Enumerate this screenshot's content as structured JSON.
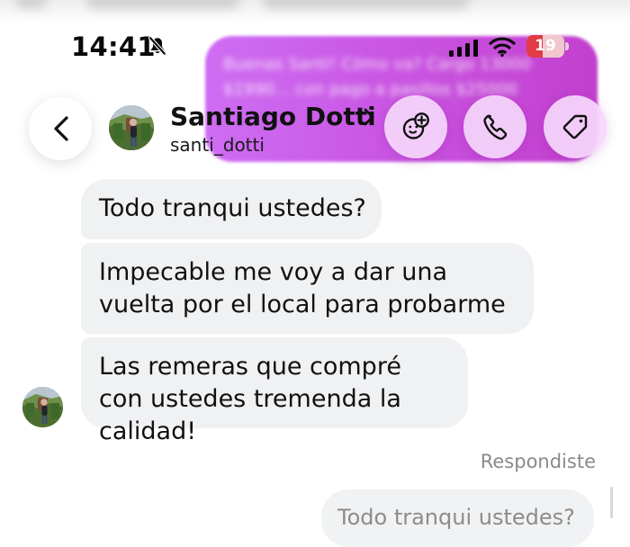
{
  "background": {
    "blurred_message_text": "Buenas Santi! Cómo va? Cargo 13000 $1990... con pago a pasillos $25000"
  },
  "status_bar": {
    "time": "14:41",
    "battery_level": "19",
    "mute_icon": "bell-slash-icon",
    "signal_icon": "cellular-signal-icon",
    "wifi_icon": "wifi-icon",
    "battery_icon": "battery-icon"
  },
  "header": {
    "contact_name": "Santiago Dotti",
    "username": "santi_dotti",
    "back_icon": "chevron-left-icon",
    "chevron_icon": "chevron-right-icon",
    "actions": [
      {
        "name": "effects",
        "icon": "face-plus-icon"
      },
      {
        "name": "call",
        "icon": "phone-icon"
      },
      {
        "name": "tag",
        "icon": "tag-icon"
      }
    ]
  },
  "messages": [
    {
      "text": "Todo tranqui ustedes?"
    },
    {
      "text": "Impecable me voy a dar una vuelta por el local para probarme"
    },
    {
      "text": "Las remeras que compré con ustedes tremenda la calidad!"
    }
  ],
  "reply_status": {
    "label": "Respondiste",
    "preview": "Todo tranqui ustedes?"
  },
  "colors": {
    "accent_purple": "#C84EE3",
    "bubble_gray": "#F0F1F3",
    "battery_red": "#E23B46"
  }
}
